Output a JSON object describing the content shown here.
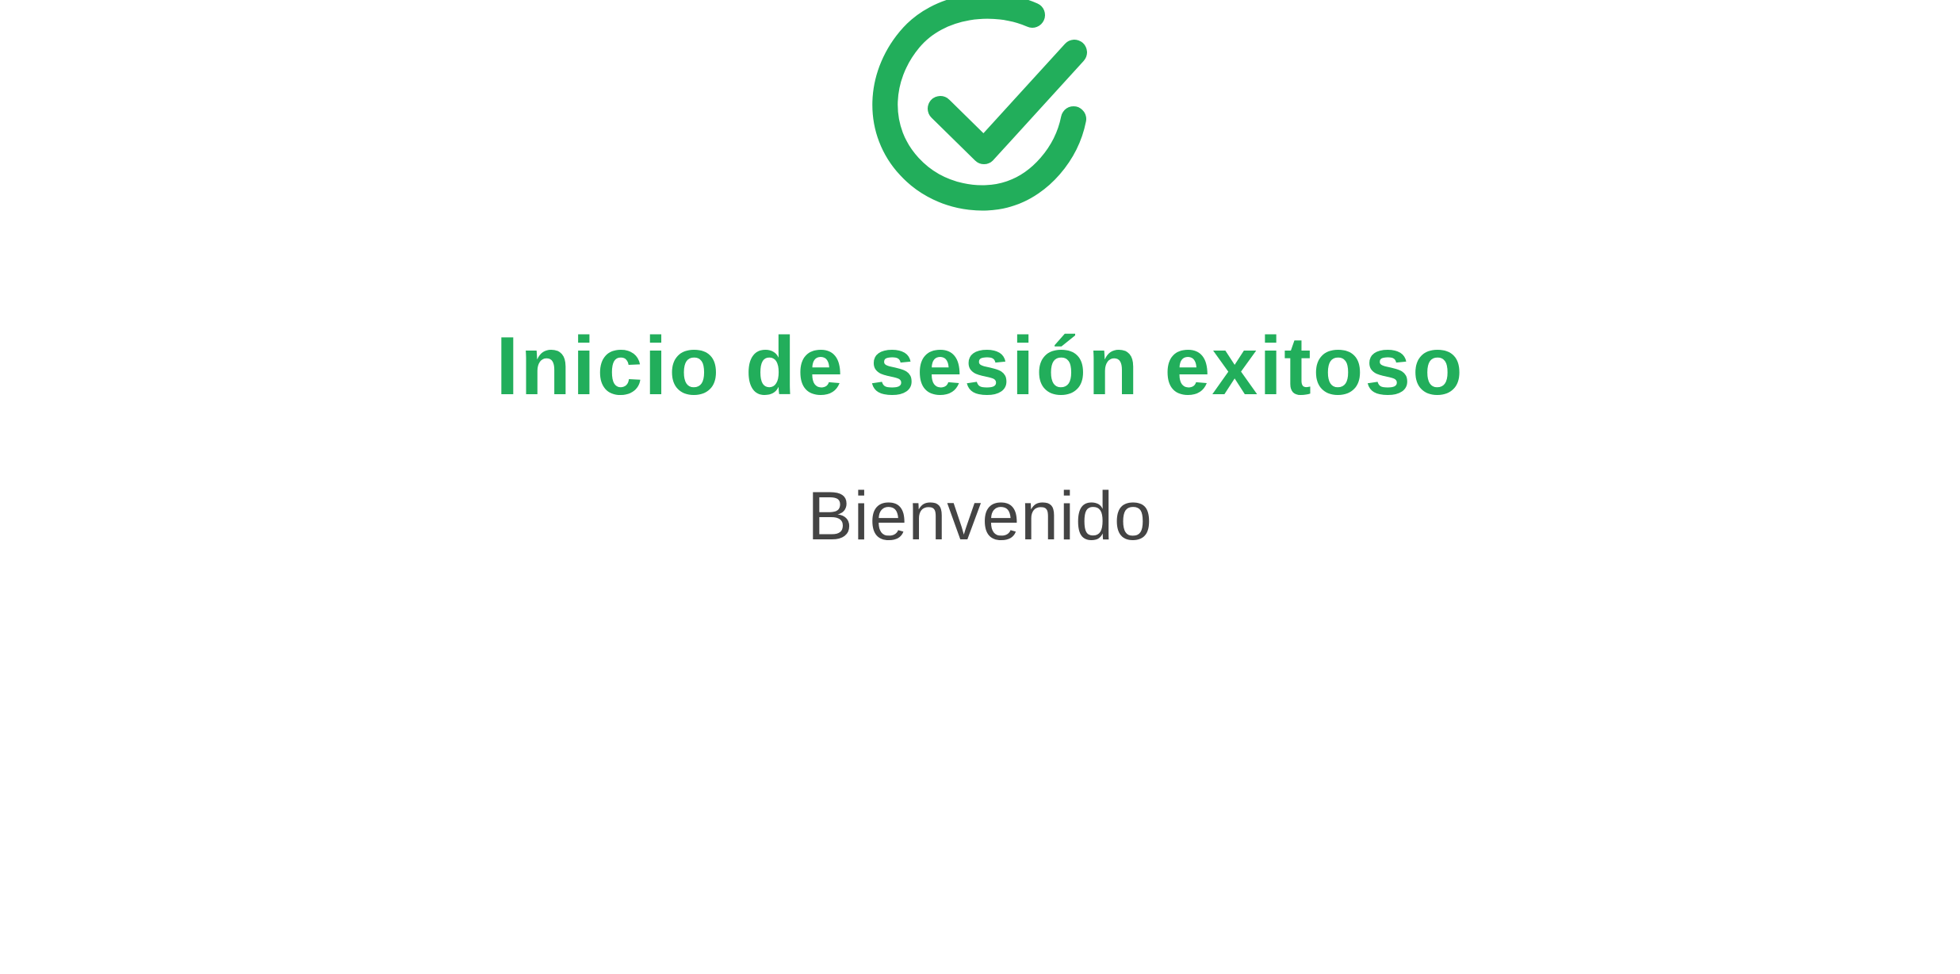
{
  "theme": {
    "accent_color": "#22AE5B",
    "text_color": "#444444",
    "background_color": "#FFFFFF"
  },
  "icon": {
    "name": "check-circle-icon"
  },
  "message": {
    "title": "Inicio de sesión exitoso",
    "subtitle": "Bienvenido"
  }
}
